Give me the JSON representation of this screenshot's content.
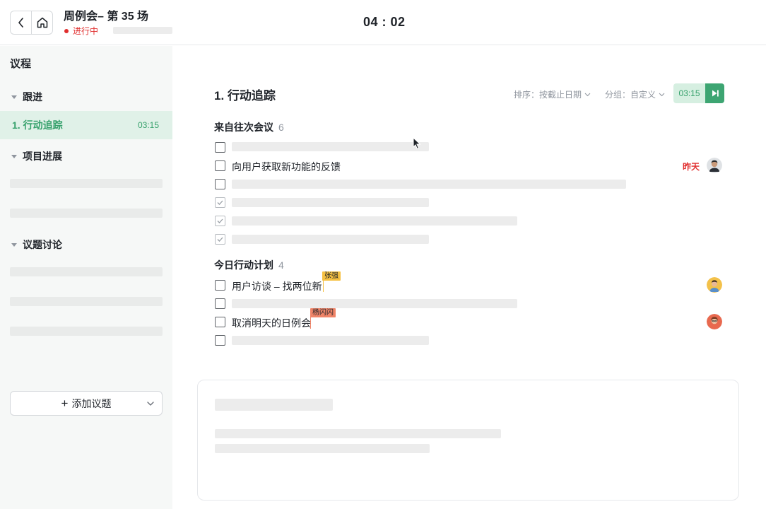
{
  "header": {
    "meeting_title": "周例会– 第 35 场",
    "status": "进行中",
    "clock": "04 : 02"
  },
  "sidebar": {
    "title": "议程",
    "sections": [
      {
        "label": "跟进"
      },
      {
        "label": "项目进展"
      },
      {
        "label": "议题讨论"
      }
    ],
    "active_item": {
      "label": "1. 行动追踪",
      "time": "03:15"
    },
    "add_label": "添加议题"
  },
  "main": {
    "title": "1. 行动追踪",
    "sort_label": "排序：按截止日期",
    "group_label": "分组：自定义",
    "timer": "03:15",
    "groups": [
      {
        "title": "来自往次会议",
        "count": "6",
        "items": [
          {
            "text": "",
            "checked": false
          },
          {
            "text": "向用户获取新功能的反馈",
            "checked": false,
            "due": "昨天",
            "avatar": "avatar-man-dark"
          },
          {
            "text": "",
            "checked": false
          },
          {
            "text": "",
            "checked": true
          },
          {
            "text": "",
            "checked": true
          },
          {
            "text": "",
            "checked": true
          }
        ]
      },
      {
        "title": "今日行动计划",
        "count": "4",
        "items": [
          {
            "text": "用户访谈 – 找两位新",
            "checked": false,
            "collaborator": "张强",
            "collaborator_color": "#f5c042",
            "avatar": "avatar-man-yellow"
          },
          {
            "text": "",
            "checked": false
          },
          {
            "text": "取消明天的日例会",
            "checked": false,
            "collaborator": "杨闪闪",
            "collaborator_color": "#f08468",
            "avatar": "avatar-woman-red"
          },
          {
            "text": "",
            "checked": false
          }
        ]
      }
    ]
  },
  "colors": {
    "accent_green": "#35a06b",
    "status_red": "#e02d2d",
    "active_bg": "#e0f1e8"
  }
}
